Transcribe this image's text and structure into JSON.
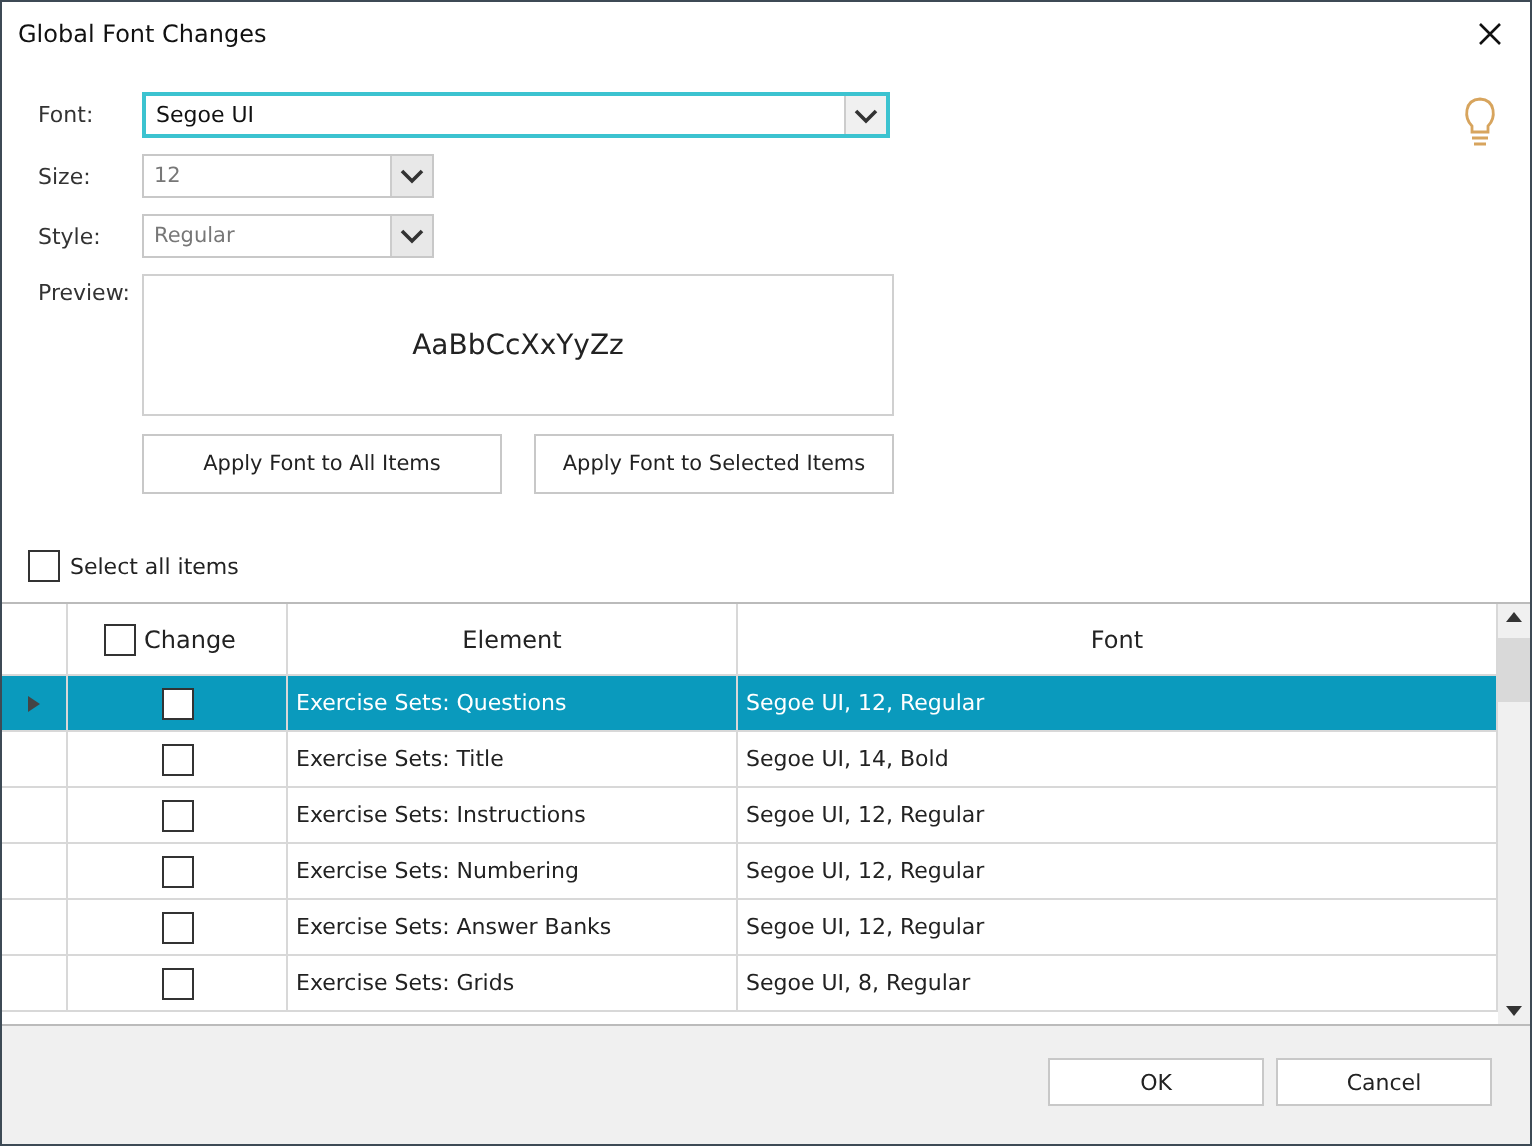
{
  "window": {
    "title": "Global Font Changes"
  },
  "form": {
    "font": {
      "label": "Font:",
      "value": "Segoe UI"
    },
    "size": {
      "label": "Size:",
      "value": "12"
    },
    "style": {
      "label": "Style:",
      "value": "Regular"
    },
    "preview": {
      "label": "Preview:",
      "sample": "AaBbCcXxYyZz"
    },
    "buttons": [
      "Apply Font to All Items",
      "Apply Font to Selected Items"
    ],
    "select_all": {
      "label": "Select all items",
      "checked": false
    }
  },
  "table": {
    "columns": [
      "Change",
      "Element",
      "Font"
    ],
    "change_all_checked": false,
    "rows": [
      {
        "selected": true,
        "checked": false,
        "element": "Exercise Sets: Questions",
        "font": "Segoe UI, 12, Regular"
      },
      {
        "selected": false,
        "checked": false,
        "element": "Exercise Sets: Title",
        "font": "Segoe UI, 14, Bold"
      },
      {
        "selected": false,
        "checked": false,
        "element": "Exercise Sets: Instructions",
        "font": "Segoe UI, 12, Regular"
      },
      {
        "selected": false,
        "checked": false,
        "element": "Exercise Sets: Numbering",
        "font": "Segoe UI, 12, Regular"
      },
      {
        "selected": false,
        "checked": false,
        "element": "Exercise Sets: Answer Banks",
        "font": "Segoe UI, 12, Regular"
      },
      {
        "selected": false,
        "checked": false,
        "element": "Exercise Sets: Grids",
        "font": "Segoe UI, 8, Regular"
      }
    ]
  },
  "footer": {
    "buttons": [
      "OK",
      "Cancel"
    ]
  }
}
